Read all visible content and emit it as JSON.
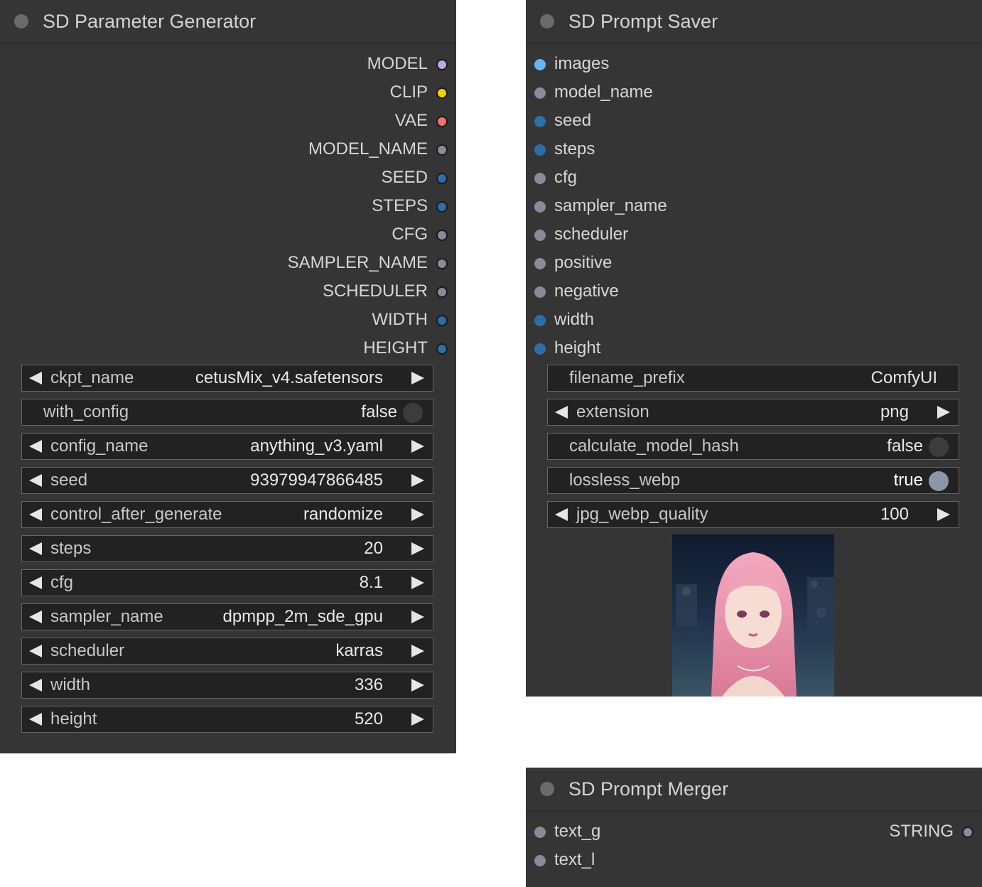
{
  "nodes": {
    "param_generator": {
      "title": "SD Parameter Generator",
      "outputs": [
        {
          "label": "MODEL",
          "color": "#b8a8e8"
        },
        {
          "label": "CLIP",
          "color": "#f5d000"
        },
        {
          "label": "VAE",
          "color": "#f07070"
        },
        {
          "label": "MODEL_NAME",
          "color": "#8a8a9a"
        },
        {
          "label": "SEED",
          "color": "#2e6ea8"
        },
        {
          "label": "STEPS",
          "color": "#2e6ea8"
        },
        {
          "label": "CFG",
          "color": "#8a8a9a"
        },
        {
          "label": "SAMPLER_NAME",
          "color": "#8a8a9a"
        },
        {
          "label": "SCHEDULER",
          "color": "#8a8a9a"
        },
        {
          "label": "WIDTH",
          "color": "#2e6ea8"
        },
        {
          "label": "HEIGHT",
          "color": "#2e6ea8"
        }
      ],
      "widgets": [
        {
          "label": "ckpt_name",
          "value": "cetusMix_v4.safetensors"
        },
        {
          "label": "with_config",
          "value": "false"
        },
        {
          "label": "config_name",
          "value": "anything_v3.yaml"
        },
        {
          "label": "seed",
          "value": "93979947866485"
        },
        {
          "label": "control_after_generate",
          "value": "randomize"
        },
        {
          "label": "steps",
          "value": "20"
        },
        {
          "label": "cfg",
          "value": "8.1"
        },
        {
          "label": "sampler_name",
          "value": "dpmpp_2m_sde_gpu"
        },
        {
          "label": "scheduler",
          "value": "karras"
        },
        {
          "label": "width",
          "value": "336"
        },
        {
          "label": "height",
          "value": "520"
        }
      ]
    },
    "prompt_saver": {
      "title": "SD Prompt Saver",
      "inputs": [
        {
          "label": "images",
          "color": "#64b5f6"
        },
        {
          "label": "model_name",
          "color": "#8a8a9a"
        },
        {
          "label": "seed",
          "color": "#2e6ea8"
        },
        {
          "label": "steps",
          "color": "#2e6ea8"
        },
        {
          "label": "cfg",
          "color": "#8a8a9a"
        },
        {
          "label": "sampler_name",
          "color": "#8a8a9a"
        },
        {
          "label": "scheduler",
          "color": "#8a8a9a"
        },
        {
          "label": "positive",
          "color": "#8a8a9a"
        },
        {
          "label": "negative",
          "color": "#8a8a9a"
        },
        {
          "label": "width",
          "color": "#2e6ea8"
        },
        {
          "label": "height",
          "color": "#2e6ea8"
        }
      ],
      "widgets": [
        {
          "label": "filename_prefix",
          "value": "ComfyUI"
        },
        {
          "label": "extension",
          "value": "png"
        },
        {
          "label": "calculate_model_hash",
          "value": "false"
        },
        {
          "label": "lossless_webp",
          "value": "true"
        },
        {
          "label": "jpg_webp_quality",
          "value": "100"
        }
      ]
    },
    "prompt_merger": {
      "title": "SD Prompt Merger",
      "inputs": [
        {
          "label": "text_g",
          "color": "#8a8a9a"
        },
        {
          "label": "text_l",
          "color": "#8a8a9a"
        }
      ],
      "outputs": [
        {
          "label": "STRING",
          "color": "#8a8a9a"
        }
      ]
    }
  }
}
